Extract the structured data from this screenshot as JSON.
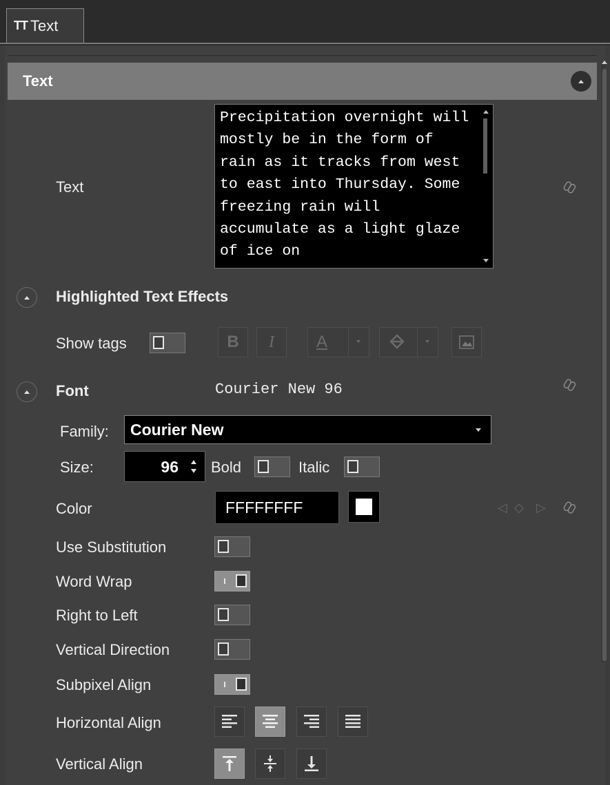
{
  "tab": {
    "icon": "text-type-icon",
    "icon_text": "TT",
    "label": "Text"
  },
  "section": {
    "title": "Text"
  },
  "text_field": {
    "label": "Text",
    "value": "Precipitation overnight will mostly be in the form of rain as it tracks from west to east into Thursday. Some freezing rain will accumulate as a light glaze of ice on"
  },
  "highlighted": {
    "title": "Highlighted Text Effects",
    "show_tags_label": "Show tags",
    "bold_label": "B",
    "italic_label": "I",
    "color_label": "A"
  },
  "font": {
    "title": "Font",
    "display": "Courier New 96",
    "family_label": "Family:",
    "family_value": "Courier New",
    "size_label": "Size:",
    "size_value": "96",
    "bold_label": "Bold",
    "italic_label": "Italic"
  },
  "color": {
    "label": "Color",
    "value": "FFFFFFFF",
    "swatch": "#FFFFFF"
  },
  "options": {
    "use_substitution": "Use Substitution",
    "word_wrap": "Word Wrap",
    "right_to_left": "Right to Left",
    "vertical_direction": "Vertical Direction",
    "subpixel_align": "Subpixel Align",
    "horizontal_align": "Horizontal Align",
    "vertical_align": "Vertical Align"
  },
  "toggles": {
    "show_tags": false,
    "bold": false,
    "italic": false,
    "use_substitution": false,
    "word_wrap": true,
    "right_to_left": false,
    "vertical_direction": false,
    "subpixel_align": true
  },
  "alignment": {
    "horizontal": "center",
    "vertical": "top"
  }
}
